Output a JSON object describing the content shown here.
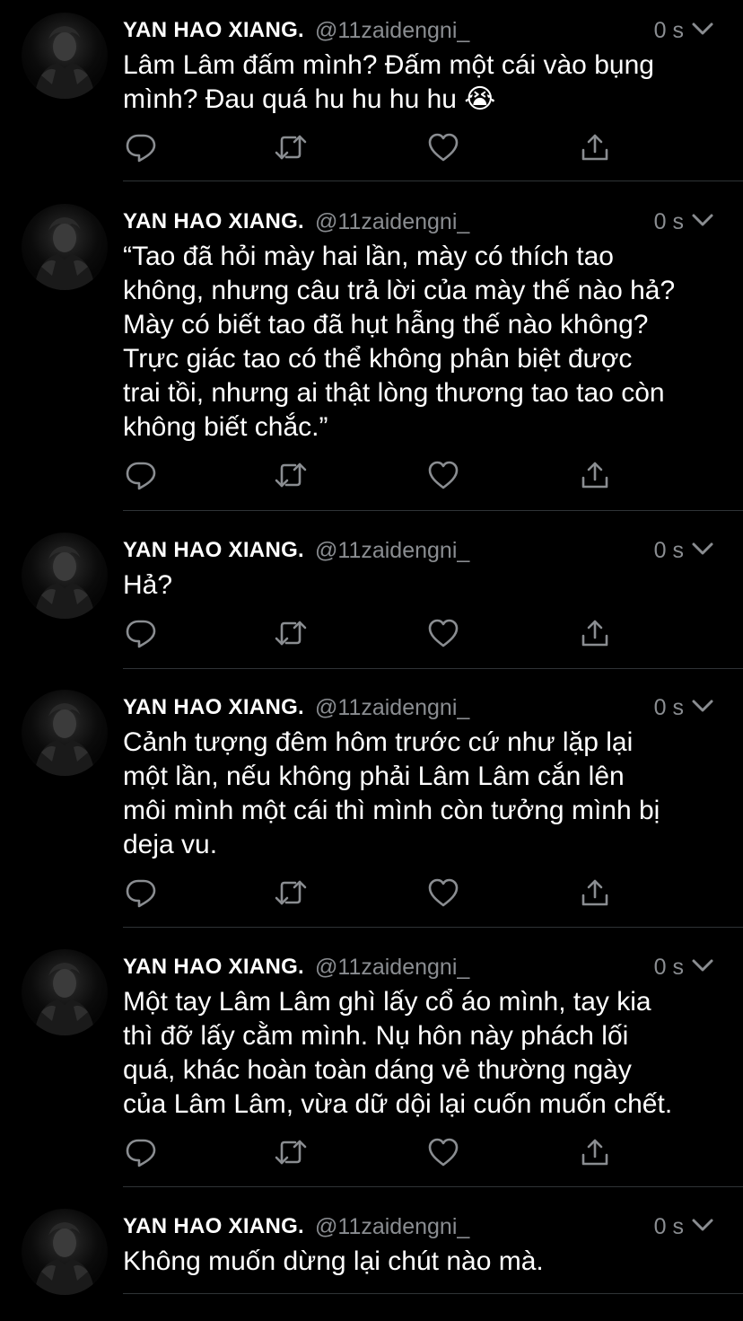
{
  "colors": {
    "background": "#000000",
    "text": "#ffffff",
    "muted": "#8a8d91",
    "divider": "#2f3336"
  },
  "author": {
    "name": "YAN HAO XIANG.",
    "handle": "@11zaidengni_",
    "time": "0 s"
  },
  "icons": {
    "reply": "reply-icon",
    "retweet": "retweet-icon",
    "like": "heart-icon",
    "share": "share-icon",
    "caret": "chevron-down-icon"
  },
  "tweets": [
    {
      "lines": [
        "Lâm Lâm đấm mình? Đấm một cái vào bụng",
        "mình? Đau quá hu hu hu hu 😭"
      ]
    },
    {
      "lines": [
        "“Tao đã hỏi mày hai lần, mày có thích tao",
        "không, nhưng câu trả lời của mày thế nào hả?",
        "Mày có biết tao đã hụt hẫng thế nào không?",
        "Trực giác tao có thể không phân biệt được",
        "trai tồi, nhưng ai thật lòng thương tao tao còn",
        "không biết chắc.”"
      ]
    },
    {
      "lines": [
        "Hả?"
      ]
    },
    {
      "lines": [
        "Cảnh tượng đêm hôm trước cứ như lặp lại",
        "một lần, nếu không phải Lâm Lâm cắn lên",
        "môi mình một cái thì mình còn tưởng mình bị",
        "deja vu."
      ]
    },
    {
      "lines": [
        "Một tay Lâm Lâm ghì lấy cổ áo mình, tay kia",
        "thì đỡ lấy cằm mình. Nụ hôn này phách lối",
        "quá, khác hoàn toàn dáng vẻ thường ngày",
        "của Lâm Lâm, vừa dữ dội lại cuốn muốn chết."
      ]
    },
    {
      "lines": [
        "Không muốn dừng lại chút nào mà."
      ]
    }
  ]
}
